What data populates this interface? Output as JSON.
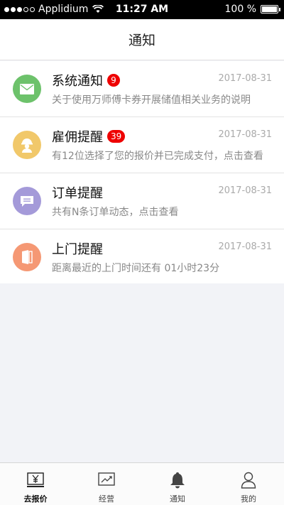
{
  "status_bar": {
    "carrier": "Applidium",
    "time": "11:27 AM",
    "battery": "100 %"
  },
  "header": {
    "title": "通知"
  },
  "notifications": [
    {
      "title": "系统通知",
      "badge": "9",
      "date": "2017-08-31",
      "desc": "关于使用万师傅卡券开展储值相关业务的说明",
      "icon": "mail-icon",
      "color": "#6dc26b"
    },
    {
      "title": "雇佣提醒",
      "badge": "39",
      "date": "2017-08-31",
      "desc": "有12位选择了您的报价并已完成支付，点击查看",
      "icon": "worker-icon",
      "color": "#f1c86a"
    },
    {
      "title": "订单提醒",
      "date": "2017-08-31",
      "desc": "共有N条订单动态，点击查看",
      "icon": "message-icon",
      "color": "#a49ad9"
    },
    {
      "title": "上门提醒",
      "date": "2017-08-31",
      "desc": "距离最近的上门时间还有 01小时23分",
      "icon": "door-icon",
      "color": "#f59874"
    }
  ],
  "tabs": [
    {
      "label": "去报价",
      "icon": "yen-icon"
    },
    {
      "label": "经营",
      "icon": "chart-icon"
    },
    {
      "label": "通知",
      "icon": "bell-icon"
    },
    {
      "label": "我的",
      "icon": "user-icon"
    }
  ]
}
